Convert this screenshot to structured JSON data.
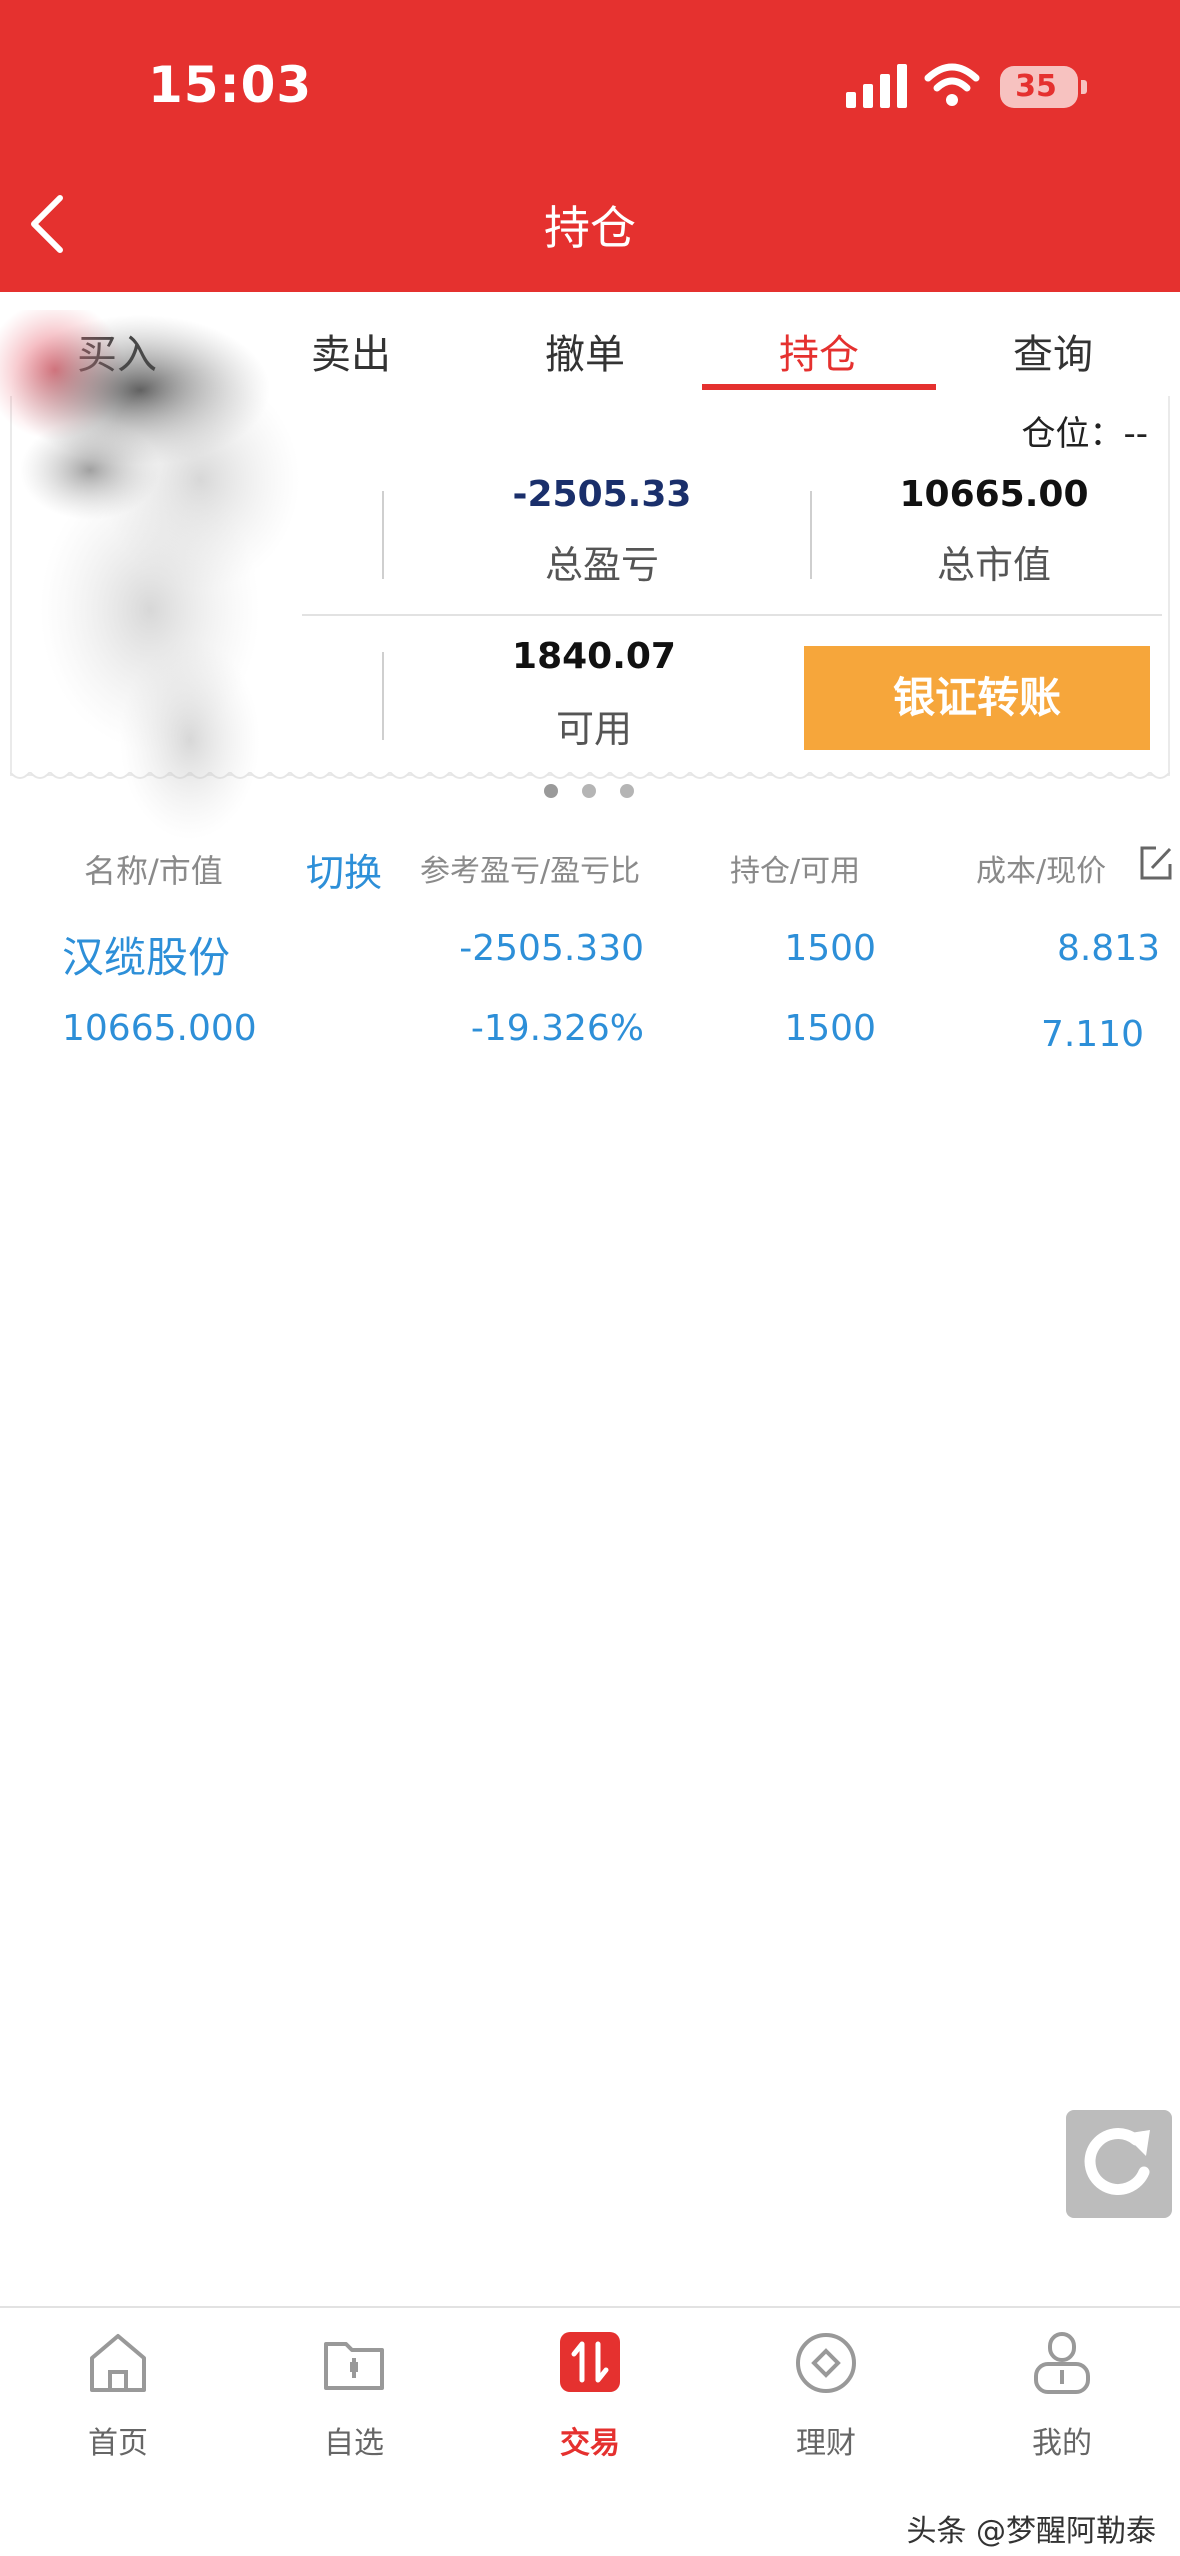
{
  "status_bar": {
    "time": "15:03",
    "battery": "35"
  },
  "header": {
    "title": "持仓"
  },
  "tabs": [
    {
      "label": "买入"
    },
    {
      "label": "卖出"
    },
    {
      "label": "撤单"
    },
    {
      "label": "持仓",
      "active": true
    },
    {
      "label": "查询"
    }
  ],
  "summary": {
    "position_label": "仓位：--",
    "total_profit_value": "-2505.33",
    "total_profit_label": "总盈亏",
    "market_value_value": "10665.00",
    "market_value_label": "总市值",
    "available_value": "1840.07",
    "available_label": "可用",
    "transfer_button": "银证转账"
  },
  "list_header": {
    "name_col": "名称/市值",
    "switch": "切换",
    "profit_col": "参考盈亏/盈亏比",
    "holding_col": "持仓/可用",
    "cost_col": "成本/现价"
  },
  "holdings": [
    {
      "name": "汉缆股份",
      "market_value": "10665.000",
      "profit": "-2505.330",
      "profit_ratio": "-19.326%",
      "holding": "1500",
      "available": "1500",
      "cost": "8.813",
      "price": "7.110"
    }
  ],
  "bottom_nav": [
    {
      "label": "首页",
      "icon": "home-icon"
    },
    {
      "label": "自选",
      "icon": "folder-icon"
    },
    {
      "label": "交易",
      "icon": "trade-icon",
      "active": true
    },
    {
      "label": "理财",
      "icon": "finance-icon"
    },
    {
      "label": "我的",
      "icon": "user-icon"
    }
  ],
  "watermark": "头条 @梦醒阿勒泰",
  "colors": {
    "brand_red": "#e5312f",
    "link_blue": "#2d8fd8",
    "button_orange": "#f6a63b",
    "value_navy": "#1a2f6b"
  }
}
